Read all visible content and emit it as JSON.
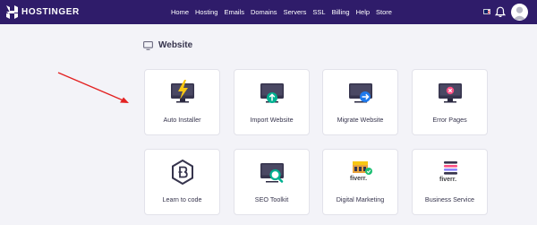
{
  "brand": {
    "name": "HOSTINGER"
  },
  "nav": [
    "Home",
    "Hosting",
    "Emails",
    "Domains",
    "Servers",
    "SSL",
    "Billing",
    "Help",
    "Store"
  ],
  "section": {
    "title": "Website"
  },
  "cards": [
    {
      "label": "Auto Installer",
      "icon": "lightning-monitor-icon"
    },
    {
      "label": "Import Website",
      "icon": "monitor-upload-icon"
    },
    {
      "label": "Migrate Website",
      "icon": "monitor-migrate-icon"
    },
    {
      "label": "Error Pages",
      "icon": "monitor-error-icon"
    },
    {
      "label": "Learn to code",
      "icon": "code-badge-icon"
    },
    {
      "label": "SEO Toolkit",
      "icon": "monitor-search-icon"
    },
    {
      "label": "Digital Marketing",
      "icon": "fiverr-store-icon",
      "badge": "fiverr."
    },
    {
      "label": "Business Service",
      "icon": "fiverr-list-icon",
      "badge": "fiverr."
    }
  ],
  "colors": {
    "topbar": "#2f1c6a",
    "background": "#f3f3f8",
    "accent": "#673de6",
    "annotation_arrow": "#e32222"
  }
}
